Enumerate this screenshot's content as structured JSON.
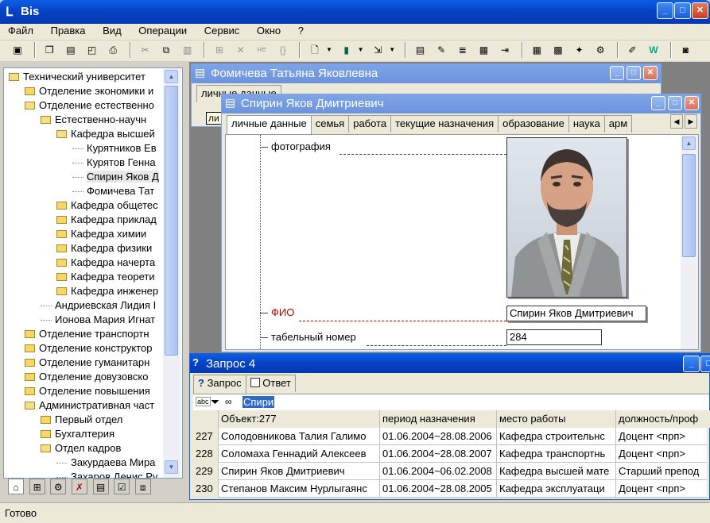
{
  "app": {
    "title": "Bis",
    "status": "Готово"
  },
  "menu": [
    "Файл",
    "Правка",
    "Вид",
    "Операции",
    "Сервис",
    "Окно",
    "?"
  ],
  "tree": {
    "items": [
      {
        "label": "Технический университет",
        "indent": 0,
        "kind": "open"
      },
      {
        "label": "Отделение экономики и",
        "indent": 1,
        "kind": "closed"
      },
      {
        "label": "Отделение естественно",
        "indent": 1,
        "kind": "open"
      },
      {
        "label": "Естественно-научн",
        "indent": 2,
        "kind": "open"
      },
      {
        "label": "Кафедра высшей",
        "indent": 3,
        "kind": "open"
      },
      {
        "label": "Курятников Ев",
        "indent": 4,
        "kind": "leaf"
      },
      {
        "label": "Курятов Генна",
        "indent": 4,
        "kind": "leaf"
      },
      {
        "label": "Спирин Яков Д",
        "indent": 4,
        "kind": "leaf",
        "selected": true
      },
      {
        "label": "Фомичева Тат",
        "indent": 4,
        "kind": "leaf"
      },
      {
        "label": "Кафедра общетес",
        "indent": 3,
        "kind": "closed"
      },
      {
        "label": "Кафедра приклад",
        "indent": 3,
        "kind": "closed"
      },
      {
        "label": "Кафедра химии",
        "indent": 3,
        "kind": "closed"
      },
      {
        "label": "Кафедра физики",
        "indent": 3,
        "kind": "closed"
      },
      {
        "label": "Кафедра начерта",
        "indent": 3,
        "kind": "closed"
      },
      {
        "label": "Кафедра теорети",
        "indent": 3,
        "kind": "closed"
      },
      {
        "label": "Кафедра инженер",
        "indent": 3,
        "kind": "closed"
      },
      {
        "label": "Андриевская Лидия I",
        "indent": 2,
        "kind": "leaf"
      },
      {
        "label": "Ионова Мария Игнат",
        "indent": 2,
        "kind": "leaf"
      },
      {
        "label": "Отделение транспортн",
        "indent": 1,
        "kind": "closed"
      },
      {
        "label": "Отделение конструктор",
        "indent": 1,
        "kind": "closed"
      },
      {
        "label": "Отделение гуманитарн",
        "indent": 1,
        "kind": "closed"
      },
      {
        "label": "Отделение довузовско",
        "indent": 1,
        "kind": "closed"
      },
      {
        "label": "Отделение повышения",
        "indent": 1,
        "kind": "closed"
      },
      {
        "label": "Административная част",
        "indent": 1,
        "kind": "open"
      },
      {
        "label": "Первый отдел",
        "indent": 2,
        "kind": "closed"
      },
      {
        "label": "Бухгалтерия",
        "indent": 2,
        "kind": "closed"
      },
      {
        "label": "Отдел кадров",
        "indent": 2,
        "kind": "open"
      },
      {
        "label": "Закурдаева Мира",
        "indent": 3,
        "kind": "leaf"
      },
      {
        "label": "Захаров Денис Ру",
        "indent": 3,
        "kind": "leaf"
      }
    ]
  },
  "win_back": {
    "title": "Фомичева Татьяна Яковлевна",
    "tab": "личные данные",
    "tooltip": "ли"
  },
  "win_front": {
    "title": "Спирин Яков Дмитриевич",
    "tabs": [
      "личные данные",
      "семья",
      "работа",
      "текущие назначения",
      "образование",
      "наука",
      "арм"
    ],
    "fields": {
      "photo_label": "фотография",
      "fio_label": "ФИО",
      "fio_value": "Спирин Яков Дмитриевич",
      "tab_label": "табельный номер",
      "tab_value": "284"
    }
  },
  "query": {
    "title": "Запрос 4",
    "tab_query": "Запрос",
    "tab_answer": "Ответ",
    "filter_value": "Спири",
    "columns": [
      "Объект:277",
      "период назначения",
      "место работы",
      "должность/проф"
    ],
    "rows": [
      {
        "n": "227",
        "name": "Солодовникова Талия Галимо",
        "period": "01.06.2004~28.08.2006",
        "place": "Кафедра строительнс",
        "pos": "Доцент <прп>"
      },
      {
        "n": "228",
        "name": "Соломаха Геннадий Алексеев",
        "period": "01.06.2004~28.08.2007",
        "place": "Кафедра транспортнь",
        "pos": "Доцент <прп>"
      },
      {
        "n": "229",
        "name": "Спирин Яков Дмитриевич",
        "period": "01.06.2004~06.02.2008",
        "place": "Кафедра высшей мате",
        "pos": "Старший препод"
      },
      {
        "n": "230",
        "name": "Степанов Максим Нурлыгаянс",
        "period": "01.06.2004~28.08.2005",
        "place": "Кафедра эксплуатаци",
        "pos": "Доцент <прп>"
      }
    ]
  },
  "colors": {
    "accent": "#0a5fe6",
    "selection": "#316ac5",
    "required": "#c00000"
  }
}
